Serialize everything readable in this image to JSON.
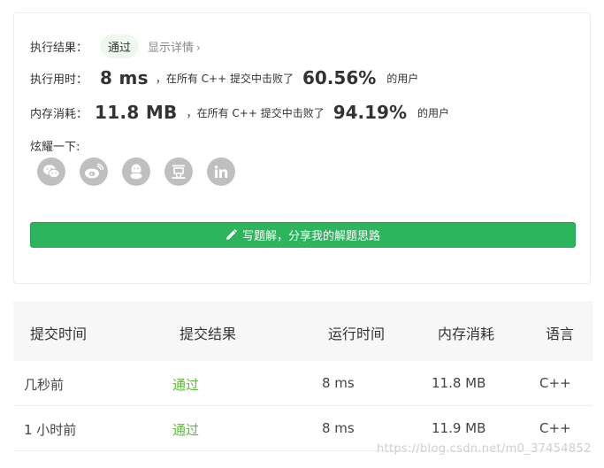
{
  "result": {
    "label": "执行结果：",
    "badge": "通过",
    "detail_link": "显示详情"
  },
  "runtime": {
    "label": "执行用时：",
    "value": "8 ms",
    "prefix": "，在所有 C++ 提交中击败了",
    "percent": "60.56%",
    "suffix": "的用户"
  },
  "memory": {
    "label": "内存消耗：",
    "value": "11.8 MB",
    "prefix": "，在所有 C++ 提交中击败了",
    "percent": "94.19%",
    "suffix": "的用户"
  },
  "share": {
    "label": "炫耀一下:",
    "icons": [
      "wechat-icon",
      "weibo-icon",
      "qq-icon",
      "douban-icon",
      "linkedin-icon"
    ]
  },
  "write_solution_button": "写题解，分享我的解题思路",
  "table": {
    "headers": [
      "提交时间",
      "提交结果",
      "运行时间",
      "内存消耗",
      "语言"
    ],
    "rows": [
      [
        "几秒前",
        "通过",
        "8 ms",
        "11.8 MB",
        "C++"
      ],
      [
        "1 小时前",
        "通过",
        "8 ms",
        "11.9 MB",
        "C++"
      ]
    ]
  },
  "watermark": "https://blog.csdn.net/m0_37454852",
  "colors": {
    "accent_green": "#2db55d",
    "pass_text": "#5bbb3a",
    "badge_bg": "#eef8ee"
  }
}
